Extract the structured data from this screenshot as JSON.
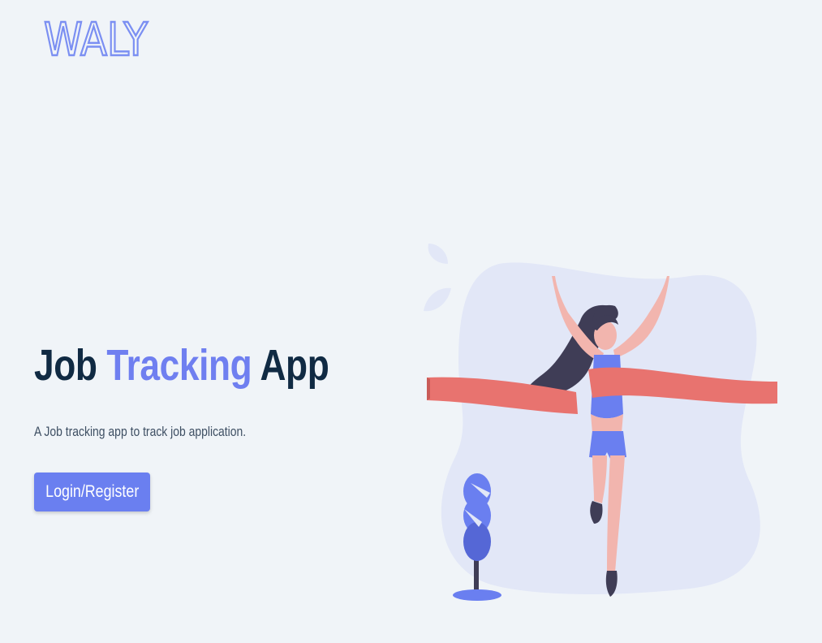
{
  "header": {
    "logo_text": "WALY"
  },
  "hero": {
    "title_part1": "Job",
    "title_accent": "Tracking",
    "title_part2": "App",
    "subtitle": "A Job tracking app to track job application.",
    "cta_label": "Login/Register"
  },
  "illustration": {
    "icon": "finish-line-runner-icon"
  },
  "colors": {
    "background": "#f0f4f8",
    "accent": "#6a7ff0",
    "title": "#102a43",
    "ribbon": "#e8736f"
  }
}
